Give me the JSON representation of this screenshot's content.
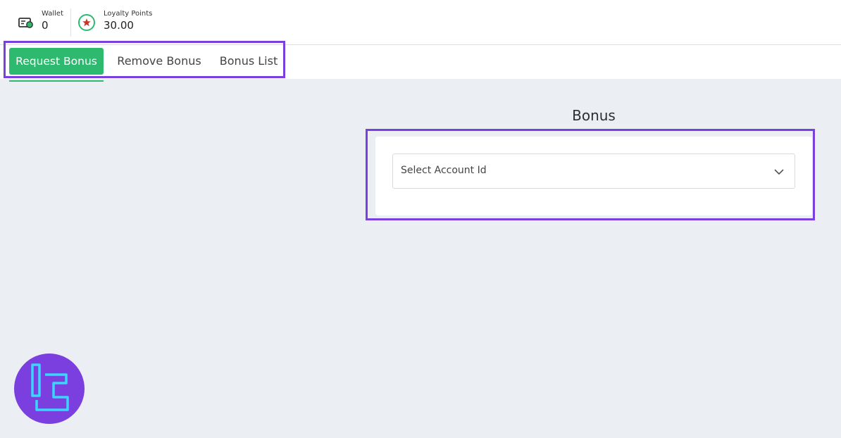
{
  "header": {
    "wallet": {
      "label": "Wallet",
      "value": "0",
      "icon": "wallet-icon"
    },
    "loyalty": {
      "label": "Loyalty Points",
      "value": "30.00",
      "icon": "star-icon"
    }
  },
  "tabs": [
    {
      "label": "Request Bonus",
      "active": true
    },
    {
      "label": "Remove Bonus",
      "active": false
    },
    {
      "label": "Bonus List",
      "active": false
    }
  ],
  "main": {
    "title": "Bonus",
    "account_select": {
      "placeholder": "Select Account Id",
      "icon": "chevron-down-icon"
    }
  },
  "colors": {
    "accent_green": "#2dba6e",
    "highlight_purple": "#7b3fe0",
    "logo_purple": "#7b3fe0",
    "logo_cyan": "#39d7ff",
    "background": "#ebeff3"
  },
  "logo": {
    "icon": "brand-logo-icon"
  }
}
